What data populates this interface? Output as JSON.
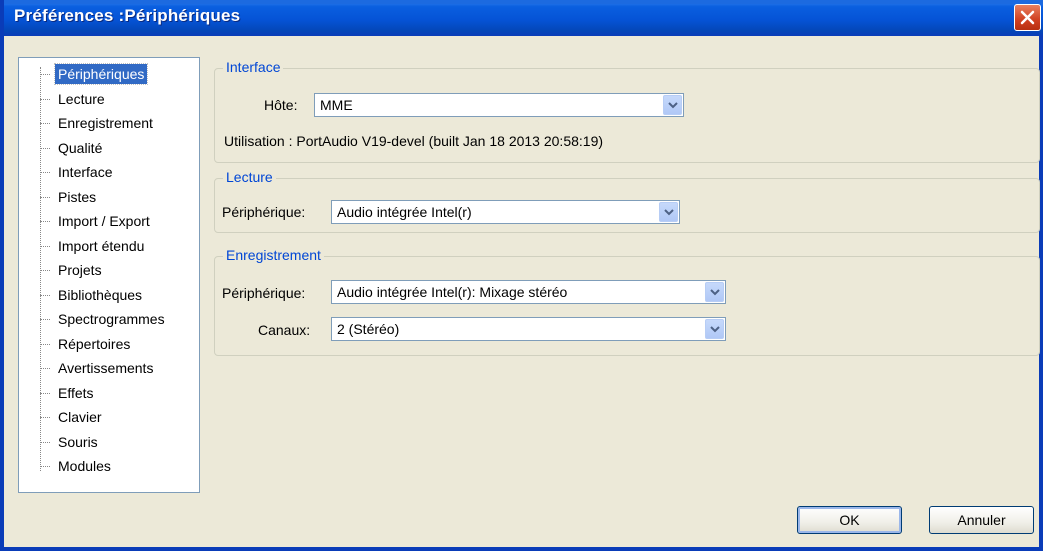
{
  "window": {
    "title": "Préférences :Périphériques"
  },
  "tree": {
    "items": [
      {
        "label": "Périphériques",
        "selected": true
      },
      {
        "label": "Lecture"
      },
      {
        "label": "Enregistrement"
      },
      {
        "label": "Qualité"
      },
      {
        "label": "Interface"
      },
      {
        "label": "Pistes"
      },
      {
        "label": "Import / Export"
      },
      {
        "label": "Import étendu"
      },
      {
        "label": "Projets"
      },
      {
        "label": "Bibliothèques"
      },
      {
        "label": "Spectrogrammes"
      },
      {
        "label": "Répertoires"
      },
      {
        "label": "Avertissements"
      },
      {
        "label": "Effets"
      },
      {
        "label": "Clavier"
      },
      {
        "label": "Souris"
      },
      {
        "label": "Modules"
      }
    ]
  },
  "interface": {
    "title": "Interface",
    "host_label": "Hôte:",
    "host_value": "MME",
    "usage_text": "Utilisation : PortAudio V19-devel (built Jan 18 2013 20:58:19)"
  },
  "playback": {
    "title": "Lecture",
    "device_label": "Périphérique:",
    "device_value": "Audio intégrée Intel(r)"
  },
  "recording": {
    "title": "Enregistrement",
    "device_label": "Périphérique:",
    "device_value": "Audio intégrée Intel(r): Mixage stéréo",
    "channels_label": "Canaux:",
    "channels_value": "2 (Stéréo)"
  },
  "buttons": {
    "ok": "OK",
    "cancel": "Annuler"
  },
  "colors": {
    "titlebar": "#0553d6",
    "selection": "#316ac5",
    "group_title": "#0046d5",
    "close": "#d04020"
  }
}
